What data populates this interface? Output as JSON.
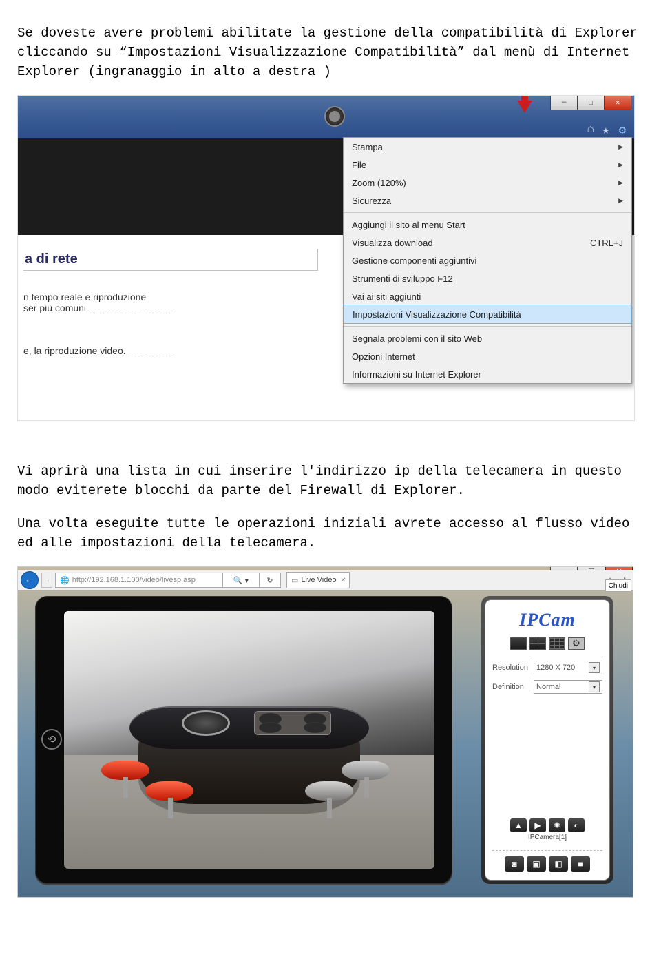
{
  "paragraphs": {
    "p1": "Se doveste avere problemi abilitate la gestione della compatibilità di Explorer cliccando su “Impostazioni Visualizzazione Compatibilità” dal menù di Internet Explorer  (ingranaggio in alto a destra )",
    "p2": "Vi aprirà una lista in cui inserire l'indirizzo ip della telecamera in questo modo eviterete blocchi da parte del Firewall di Explorer.",
    "p3": "Una volta eseguite tutte le operazioni iniziali avrete accesso al flusso video ed alle impostazioni della telecamera."
  },
  "ie_menu": {
    "items_top": [
      {
        "label": "Stampa",
        "sub": true
      },
      {
        "label": "File",
        "sub": true
      },
      {
        "label": "Zoom (120%)",
        "sub": true
      },
      {
        "label": "Sicurezza",
        "sub": true
      }
    ],
    "items_mid": [
      {
        "label": "Aggiungi il sito al menu Start"
      },
      {
        "label": "Visualizza download",
        "accel": "CTRL+J"
      },
      {
        "label": "Gestione componenti aggiuntivi"
      },
      {
        "label": "Strumenti di sviluppo F12"
      },
      {
        "label": "Vai ai siti aggiunti"
      }
    ],
    "highlight": "Impostazioni Visualizzazione Compatibilità",
    "items_bot": [
      {
        "label": "Segnala problemi con il sito Web"
      },
      {
        "label": "Opzioni Internet"
      },
      {
        "label": "Informazioni su Internet Explorer"
      }
    ]
  },
  "ie_toolbar": {
    "home": "⌂",
    "star": "★",
    "gear": "⚙"
  },
  "ie_page": {
    "heading": "a di rete",
    "line1": "n tempo reale e riproduzione",
    "line2": "ser più comuni",
    "line3": "e, la riproduzione video."
  },
  "ipcam": {
    "address": "http://192.168.1.100/video/livesp.asp",
    "search_glyph": "🔍 ▾ ",
    "refresh": "↻",
    "tab": "Live Video",
    "tooltip": "Chiudi",
    "title": "IPCam",
    "resolution_label": "Resolution",
    "resolution_value": "1280 X 720",
    "definition_label": "Definition",
    "definition_value": "Normal",
    "camera_label": "IPCamera[1]",
    "row1": [
      "▲",
      "▶",
      "✺",
      "◐"
    ],
    "row2": [
      "◙",
      "▣",
      "◧",
      "■"
    ]
  },
  "win_buttons": {
    "min": "—",
    "max": "☐",
    "close": "✕"
  }
}
